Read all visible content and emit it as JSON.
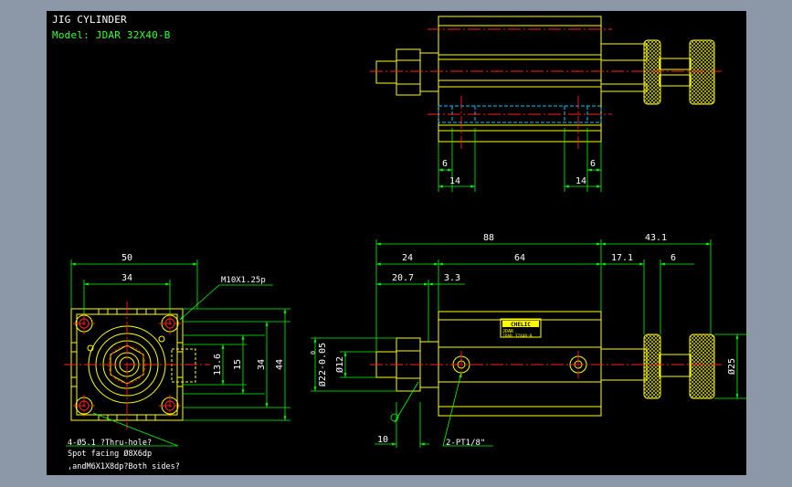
{
  "drawing": {
    "title": "JIG CYLINDER",
    "model": "Model: JDAR 32X40-B"
  },
  "colors": {
    "background": "#000000",
    "frame": "#8c98a8",
    "outline": "#ffff00",
    "dimension": "#00ff00",
    "centerline": "#ff2020",
    "hidden": "#00c8ff",
    "text": "#ffffff"
  },
  "front_view": {
    "dims": {
      "width_overall": "50",
      "hole_pitch_h": "34",
      "thread_dia": "13.6",
      "port_dia": "15",
      "hole_pitch_v": "34",
      "height_overall": "44"
    },
    "thread_callout": "M10X1.25p",
    "notes": [
      "4-Ø5.1 ?Thru-hole?",
      "Spot facing Ø8X6dp",
      ",andM6X1X8dp?Both sides?"
    ]
  },
  "top_view": {
    "dims": {
      "port_offset_left": "6",
      "port_width_left": "14",
      "port_offset_right": "6",
      "port_width_right": "14"
    }
  },
  "side_view": {
    "dims": {
      "body_length": "88",
      "knob_length": "43.1",
      "front_length": "24",
      "cyl_length": "64",
      "knob_a": "17.1",
      "knob_b": "6",
      "rod_ext": "20.7",
      "rod_gap": "3.3",
      "rod_dia": "Ø22-0.05",
      "rod_dia_tol": "0",
      "piston_dia": "Ø12",
      "knob_dia": "Ø25",
      "nut_width": "10"
    },
    "port_callout": "2-PT1/8\"",
    "label_brand": "CHELIC",
    "label_line1": "JDAR",
    "label_line2": "JDAR 32X40-B"
  }
}
